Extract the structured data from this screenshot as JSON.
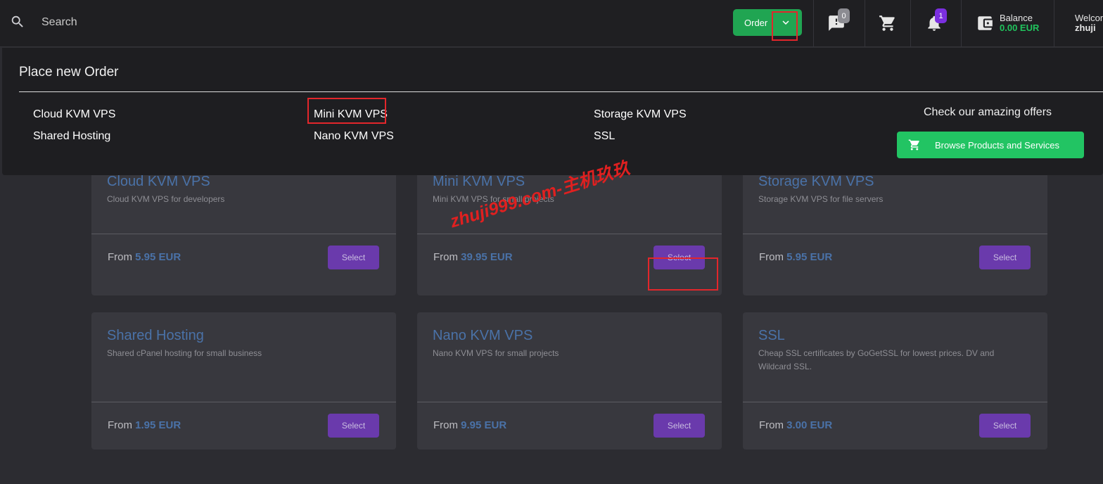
{
  "search": {
    "placeholder": "Search"
  },
  "order": {
    "label": "Order"
  },
  "badges": {
    "tickets": "0",
    "notifications": "1"
  },
  "balance": {
    "label": "Balance",
    "amount": "0.00 EUR"
  },
  "welcome": {
    "label": "Welcome",
    "user": "zhuji"
  },
  "dropdown": {
    "title": "Place new Order",
    "items": [
      {
        "label": "Cloud KVM VPS"
      },
      {
        "label": "Shared Hosting"
      },
      {
        "label": "Mini KVM VPS"
      },
      {
        "label": "Nano KVM VPS"
      },
      {
        "label": "Storage KVM VPS"
      },
      {
        "label": "SSL"
      }
    ],
    "offers_text": "Check our amazing offers",
    "browse_label": "Browse Products and Services"
  },
  "cards": [
    {
      "title": "Cloud KVM VPS",
      "desc": "Cloud KVM VPS for developers",
      "from": "From",
      "price": "5.95 EUR",
      "button": "Select"
    },
    {
      "title": "Mini KVM VPS",
      "desc": "Mini KVM VPS for small projects",
      "from": "From",
      "price": "39.95 EUR",
      "button": "Select"
    },
    {
      "title": "Storage KVM VPS",
      "desc": "Storage KVM VPS for file servers",
      "from": "From",
      "price": "5.95 EUR",
      "button": "Select"
    },
    {
      "title": "Shared Hosting",
      "desc": "Shared cPanel hosting for small business",
      "from": "From",
      "price": "1.95 EUR",
      "button": "Select"
    },
    {
      "title": "Nano KVM VPS",
      "desc": "Nano KVM VPS for small projects",
      "from": "From",
      "price": "9.95 EUR",
      "button": "Select"
    },
    {
      "title": "SSL",
      "desc": "Cheap SSL certificates by GoGetSSL for lowest prices. DV and Wildcard SSL.",
      "from": "From",
      "price": "3.00 EUR",
      "button": "Select"
    }
  ],
  "watermark": "zhuji999.com-主机玖玖",
  "icons": {
    "search": "search-icon",
    "chevron": "chevron-down-icon",
    "tickets": "ticket-alert-icon",
    "cart": "cart-icon",
    "notifications": "bell-icon",
    "wallet": "wallet-icon"
  },
  "colors": {
    "order_green": "#20a552",
    "browse_green": "#22c463",
    "select_purple": "#6a3aac",
    "title_blue": "#4a72a8",
    "balance_green": "#20c35d",
    "highlight_red": "#e3262b"
  }
}
